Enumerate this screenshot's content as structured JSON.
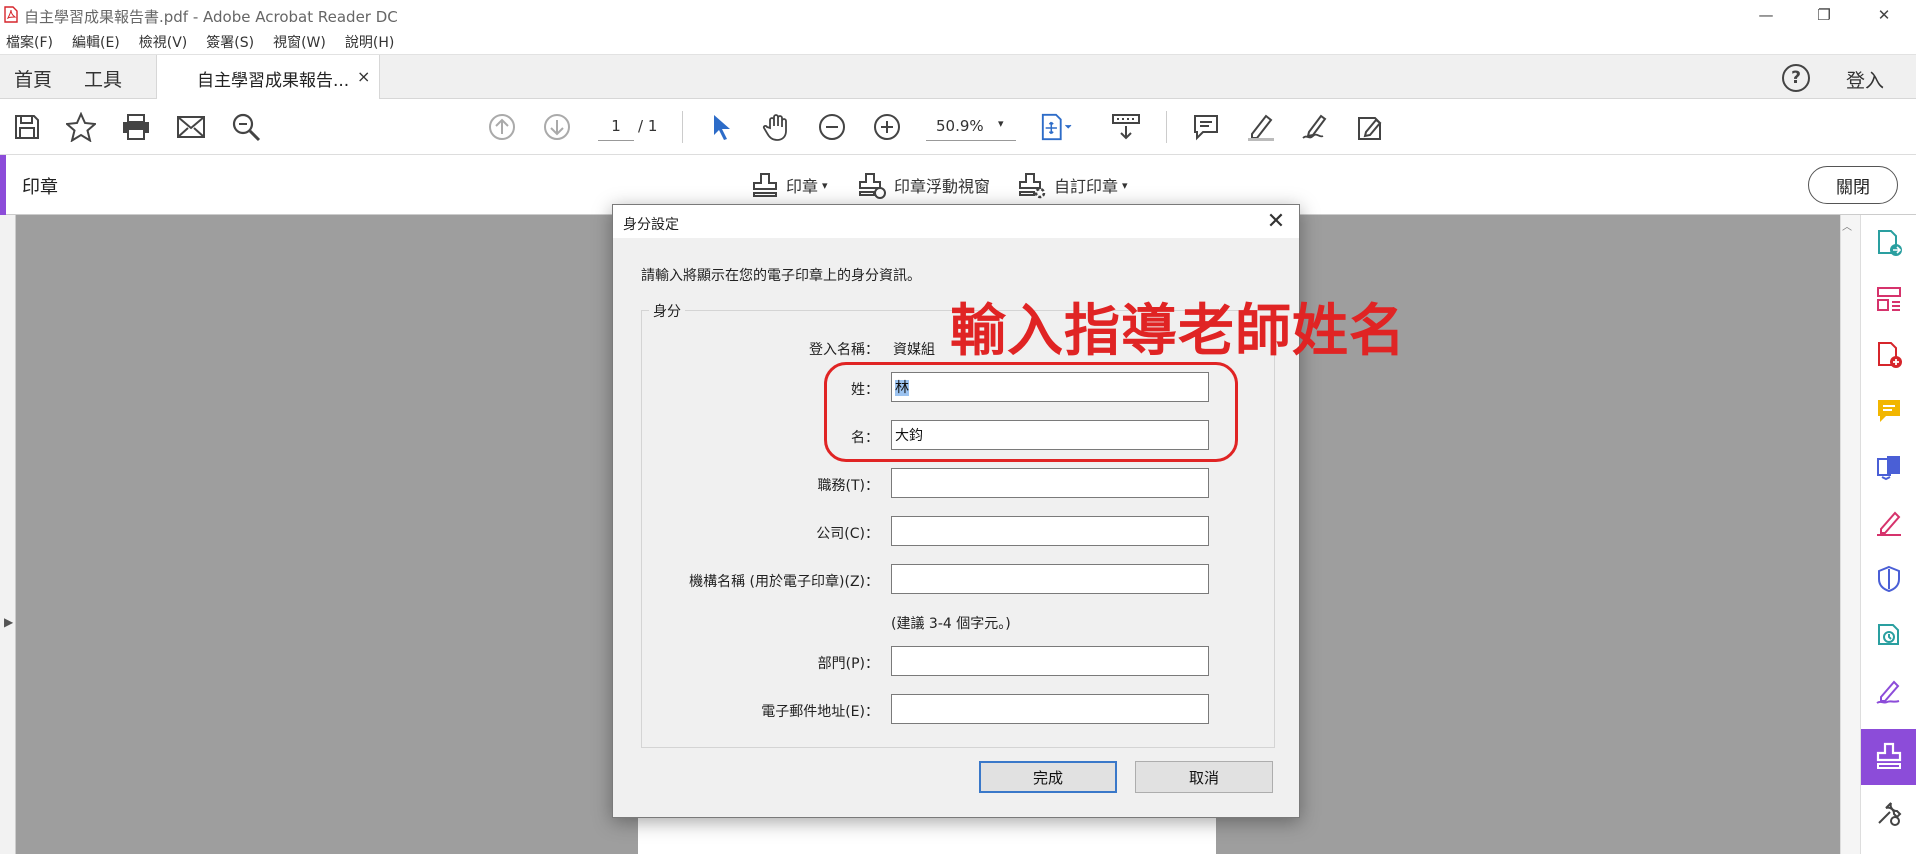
{
  "window": {
    "title": "自主學習成果報告書.pdf - Adobe Acrobat Reader DC",
    "minimize": "—",
    "restore": "❐",
    "close": "✕"
  },
  "menu": [
    "檔案(F)",
    "編輯(E)",
    "檢視(V)",
    "簽署(S)",
    "視窗(W)",
    "說明(H)"
  ],
  "tabs": {
    "home": "首頁",
    "tools": "工具",
    "document": "自主學習成果報告...",
    "document_close": "×",
    "help": "?",
    "sign_in": "登入"
  },
  "toolbar": {
    "page_current": "1",
    "page_total": "/ 1",
    "zoom": "50.9%",
    "zoom_caret": "▾"
  },
  "stamp_bar": {
    "title": "印章",
    "stamps_label": "印章",
    "stamp_palette_label": "印章浮動視窗",
    "custom_stamps_label": "自訂印章",
    "close_label": "關閉"
  },
  "dialog": {
    "title": "身分設定",
    "close": "✕",
    "instruction": "請輸入將顯示在您的電子印章上的身分資訊。",
    "group_label": "身分",
    "login_label": "登入名稱：",
    "login_value": "資媒組",
    "fields": {
      "last_name_label": "姓：",
      "last_name_value": "林",
      "first_name_label": "名：",
      "first_name_value": "大鈞",
      "title_label": "職務(T)：",
      "title_value": "",
      "company_label": "公司(C)：",
      "company_value": "",
      "org_label": "機構名稱 (用於電子印章)(Z)：",
      "org_value": "",
      "org_hint": "(建議 3-4 個字元。)",
      "dept_label": "部門(P)：",
      "dept_value": "",
      "email_label": "電子郵件地址(E)：",
      "email_value": ""
    },
    "ok_label": "完成",
    "cancel_label": "取消"
  },
  "annotation": {
    "text": "輸入指導老師姓名",
    "color": "#e02424"
  },
  "colors": {
    "accent_purple": "#8c4cd9",
    "primary_blue": "#3a78c9"
  }
}
